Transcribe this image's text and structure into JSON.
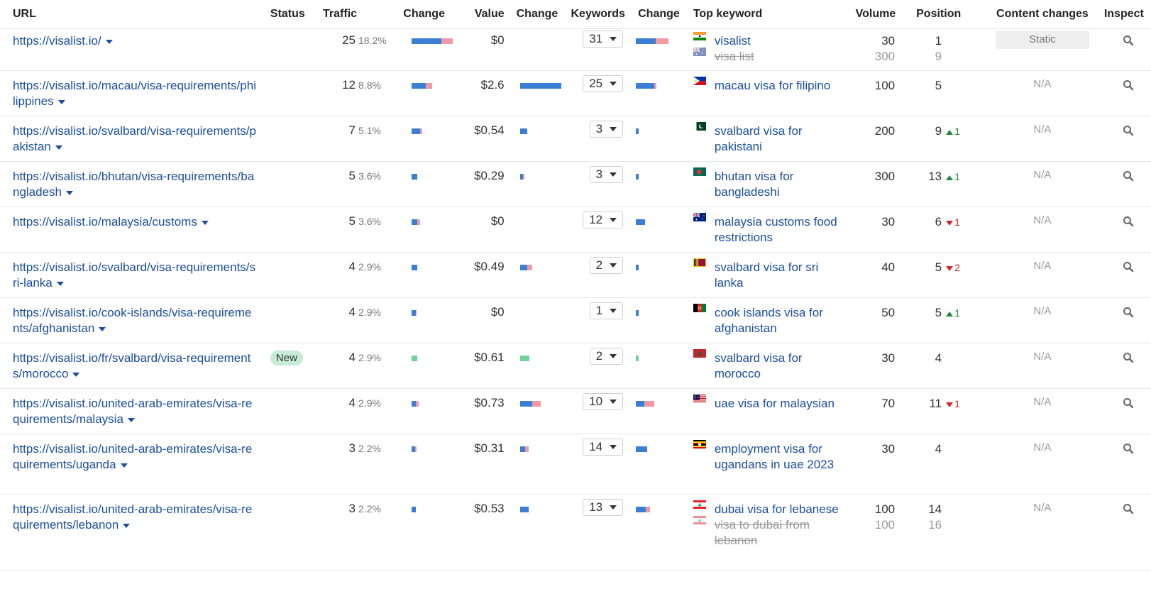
{
  "headers": {
    "url": "URL",
    "status": "Status",
    "traffic": "Traffic",
    "traffic_change": "Change",
    "value": "Value",
    "value_change": "Change",
    "keywords": "Keywords",
    "keywords_change": "Change",
    "top_keyword": "Top keyword",
    "volume": "Volume",
    "position": "Position",
    "content_changes": "Content changes",
    "inspect": "Inspect"
  },
  "colors": {
    "link": "#1a4d9e",
    "bar_blue": "#3a7fd5",
    "bar_pink": "#f09aa3",
    "bar_green": "#73d19a",
    "up": "#1e8c3a",
    "down": "#d0282e"
  },
  "rows": [
    {
      "url": "https://visalist.io/",
      "status": "",
      "traffic": "25",
      "traffic_pct": "18.2%",
      "traffic_bar": {
        "blue": 0.72,
        "pink": 0.28,
        "total": 1.0
      },
      "value": "$0",
      "value_bar": {
        "blue": 0,
        "pink": 0,
        "total": 0
      },
      "keywords": "31",
      "kw_bar": {
        "blue": 0.6,
        "pink": 0.4,
        "total": 0.8
      },
      "top_keywords": [
        {
          "text": "visalist",
          "flag": "india",
          "volume": "30",
          "position": "1",
          "struck": false
        },
        {
          "text": "visa list",
          "flag": "australia",
          "volume": "300",
          "position": "9",
          "struck": true
        }
      ],
      "pos_change": null,
      "content_changes": "Static"
    },
    {
      "url": "https://visalist.io/macau/visa-requirements/philippines",
      "status": "",
      "traffic": "12",
      "traffic_pct": "8.8%",
      "traffic_bar": {
        "blue": 0.7,
        "pink": 0.3,
        "total": 0.5
      },
      "value": "$2.6",
      "value_bar": {
        "blue": 1.0,
        "pink": 0,
        "total": 1.0
      },
      "keywords": "25",
      "kw_bar": {
        "blue": 0.9,
        "pink": 0.1,
        "total": 0.5
      },
      "top_keywords": [
        {
          "text": "macau visa for filipino",
          "flag": "philippines",
          "volume": "100",
          "position": "5",
          "struck": false
        }
      ],
      "pos_change": null,
      "content_changes": "N/A"
    },
    {
      "url": "https://visalist.io/svalbard/visa-requirements/pakistan",
      "status": "",
      "traffic": "7",
      "traffic_pct": "5.1%",
      "traffic_bar": {
        "blue": 0.8,
        "pink": 0.2,
        "total": 0.25
      },
      "value": "$0.54",
      "value_bar": {
        "blue": 1.0,
        "pink": 0,
        "total": 0.18
      },
      "keywords": "3",
      "kw_bar": {
        "blue": 1.0,
        "pink": 0,
        "total": 0.06
      },
      "top_keywords": [
        {
          "text": "svalbard visa for pakistani",
          "flag": "pakistan",
          "volume": "200",
          "position": "9",
          "struck": false
        }
      ],
      "pos_change": {
        "dir": "up",
        "value": "1"
      },
      "content_changes": "N/A"
    },
    {
      "url": "https://visalist.io/bhutan/visa-requirements/bangladesh",
      "status": "",
      "traffic": "5",
      "traffic_pct": "3.6%",
      "traffic_bar": {
        "blue": 1.0,
        "pink": 0,
        "total": 0.14
      },
      "value": "$0.29",
      "value_bar": {
        "blue": 0.7,
        "pink": 0.3,
        "total": 0.1
      },
      "keywords": "3",
      "kw_bar": {
        "blue": 1.0,
        "pink": 0,
        "total": 0.06
      },
      "top_keywords": [
        {
          "text": "bhutan visa for bangladeshi",
          "flag": "bangladesh",
          "volume": "300",
          "position": "13",
          "struck": false
        }
      ],
      "pos_change": {
        "dir": "up",
        "value": "1"
      },
      "content_changes": "N/A"
    },
    {
      "url": "https://visalist.io/malaysia/customs",
      "status": "",
      "traffic": "5",
      "traffic_pct": "3.6%",
      "traffic_bar": {
        "blue": 0.65,
        "pink": 0.35,
        "total": 0.2
      },
      "value": "$0",
      "value_bar": {
        "blue": 0,
        "pink": 0,
        "total": 0
      },
      "keywords": "12",
      "kw_bar": {
        "blue": 1.0,
        "pink": 0,
        "total": 0.22
      },
      "top_keywords": [
        {
          "text": "malaysia customs food restrictions",
          "flag": "australia",
          "volume": "30",
          "position": "6",
          "struck": false
        }
      ],
      "pos_change": {
        "dir": "down",
        "value": "1"
      },
      "content_changes": "N/A"
    },
    {
      "url": "https://visalist.io/svalbard/visa-requirements/sri-lanka",
      "status": "",
      "traffic": "4",
      "traffic_pct": "2.9%",
      "traffic_bar": {
        "blue": 1.0,
        "pink": 0,
        "total": 0.14
      },
      "value": "$0.49",
      "value_bar": {
        "blue": 0.6,
        "pink": 0.4,
        "total": 0.3
      },
      "keywords": "2",
      "kw_bar": {
        "blue": 1.0,
        "pink": 0,
        "total": 0.06
      },
      "top_keywords": [
        {
          "text": "svalbard visa for sri lanka",
          "flag": "sri-lanka",
          "volume": "40",
          "position": "5",
          "struck": false
        }
      ],
      "pos_change": {
        "dir": "down",
        "value": "2"
      },
      "content_changes": "N/A"
    },
    {
      "url": "https://visalist.io/cook-islands/visa-requirements/afghanistan",
      "status": "",
      "traffic": "4",
      "traffic_pct": "2.9%",
      "traffic_bar": {
        "blue": 0.8,
        "pink": 0.2,
        "total": 0.12
      },
      "value": "$0",
      "value_bar": {
        "blue": 0,
        "pink": 0,
        "total": 0
      },
      "keywords": "1",
      "kw_bar": {
        "blue": 1.0,
        "pink": 0,
        "total": 0.04
      },
      "top_keywords": [
        {
          "text": "cook islands visa for afghanistan",
          "flag": "afghanistan",
          "volume": "50",
          "position": "5",
          "struck": false
        }
      ],
      "pos_change": {
        "dir": "up",
        "value": "1"
      },
      "content_changes": "N/A"
    },
    {
      "url": "https://visalist.io/fr/svalbard/visa-requirements/morocco",
      "status": "New",
      "traffic": "4",
      "traffic_pct": "2.9%",
      "traffic_bar": {
        "green": 1.0,
        "total": 0.14
      },
      "value": "$0.61",
      "value_bar": {
        "green": 1.0,
        "total": 0.22
      },
      "keywords": "2",
      "kw_bar": {
        "green": 1.0,
        "total": 0.04
      },
      "top_keywords": [
        {
          "text": "svalbard visa for morocco",
          "flag": "morocco",
          "volume": "30",
          "position": "4",
          "struck": false
        }
      ],
      "pos_change": null,
      "content_changes": "N/A"
    },
    {
      "url": "https://visalist.io/united-arab-emirates/visa-requirements/malaysia",
      "status": "",
      "traffic": "4",
      "traffic_pct": "2.9%",
      "traffic_bar": {
        "blue": 0.6,
        "pink": 0.4,
        "total": 0.18
      },
      "value": "$0.73",
      "value_bar": {
        "blue": 0.6,
        "pink": 0.4,
        "total": 0.5
      },
      "keywords": "10",
      "kw_bar": {
        "blue": 0.45,
        "pink": 0.55,
        "total": 0.45
      },
      "top_keywords": [
        {
          "text": "uae visa for malaysian",
          "flag": "malaysia",
          "volume": "70",
          "position": "11",
          "struck": false
        }
      ],
      "pos_change": {
        "dir": "down",
        "value": "1"
      },
      "content_changes": "N/A"
    },
    {
      "url": "https://visalist.io/united-arab-emirates/visa-requirements/uganda",
      "status": "",
      "traffic": "3",
      "traffic_pct": "2.2%",
      "traffic_bar": {
        "blue": 0.7,
        "pink": 0.3,
        "total": 0.12
      },
      "value": "$0.31",
      "value_bar": {
        "blue": 0.6,
        "pink": 0.4,
        "total": 0.2
      },
      "keywords": "14",
      "kw_bar": {
        "blue": 1.0,
        "pink": 0,
        "total": 0.28
      },
      "top_keywords": [
        {
          "text": "employment visa for ugandans in uae 2023",
          "flag": "uganda",
          "volume": "30",
          "position": "4",
          "struck": false
        }
      ],
      "pos_change": null,
      "content_changes": "N/A"
    },
    {
      "url": "https://visalist.io/united-arab-emirates/visa-requirements/lebanon",
      "status": "",
      "traffic": "3",
      "traffic_pct": "2.2%",
      "traffic_bar": {
        "blue": 1.0,
        "pink": 0,
        "total": 0.1
      },
      "value": "$0.53",
      "value_bar": {
        "blue": 1.0,
        "pink": 0,
        "total": 0.2
      },
      "keywords": "13",
      "kw_bar": {
        "blue": 0.7,
        "pink": 0.3,
        "total": 0.35
      },
      "top_keywords": [
        {
          "text": "dubai visa for lebanese",
          "flag": "lebanon",
          "volume": "100",
          "position": "14",
          "struck": false
        },
        {
          "text": "visa to dubai from lebanon",
          "flag": "lebanon",
          "volume": "100",
          "position": "16",
          "struck": true
        }
      ],
      "pos_change": null,
      "content_changes": "N/A"
    }
  ]
}
